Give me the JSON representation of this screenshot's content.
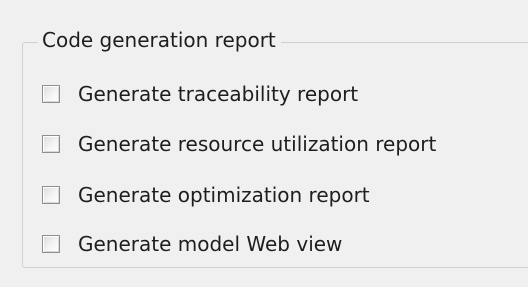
{
  "group": {
    "title": "Code generation report",
    "options": [
      {
        "label": "Generate traceability report",
        "checked": false
      },
      {
        "label": "Generate resource utilization report",
        "checked": false
      },
      {
        "label": "Generate optimization report",
        "checked": false
      },
      {
        "label": "Generate model Web view",
        "checked": false
      }
    ]
  },
  "colors": {
    "background": "#f0f0f0",
    "group_border": "#d0d0d0",
    "checkbox_border": "#8f8f8f",
    "text": "#1e1e1e"
  }
}
